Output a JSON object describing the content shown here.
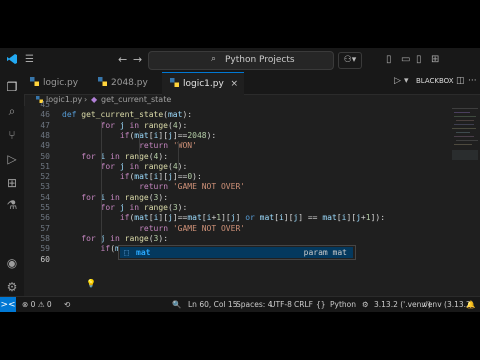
{
  "titlebar": {
    "search_text": "Python Projects",
    "nav_back": "←",
    "nav_forward": "→",
    "copilot": "⚇▾"
  },
  "tabs": [
    {
      "label": "logic.py",
      "active": false
    },
    {
      "label": "2048.py",
      "active": false
    },
    {
      "label": "logic1.py",
      "active": true
    }
  ],
  "tab_actions": {
    "run": "▷",
    "run_menu": "▾",
    "blackbox": "BLACKBOX",
    "split": "◫",
    "more": "···"
  },
  "breadcrumb": {
    "file": "logic1.py",
    "symbol": "get_current_state"
  },
  "code_lines": [
    {
      "num": "46",
      "indent": 0,
      "tokens": [
        [
          "kd",
          "def "
        ],
        [
          "fn",
          "get_current_state"
        ],
        [
          "",
          "("
        ],
        [
          "vr",
          "mat"
        ],
        [
          "",
          "):"
        ]
      ]
    },
    {
      "num": "47",
      "indent": 4,
      "tokens": [
        [
          "kw",
          "for "
        ],
        [
          "vr",
          "j"
        ],
        [
          "kw",
          " in "
        ],
        [
          "fn",
          "range"
        ],
        [
          "",
          "("
        ],
        [
          "nm",
          "4"
        ],
        [
          "",
          "):"
        ]
      ]
    },
    {
      "num": "48",
      "indent": 6,
      "tokens": [
        [
          "kw",
          "if"
        ],
        [
          "",
          "("
        ],
        [
          "vr",
          "mat"
        ],
        [
          "",
          "["
        ],
        [
          "vr",
          "i"
        ],
        [
          "",
          "]["
        ],
        [
          "vr",
          "j"
        ],
        [
          "",
          "]=="
        ],
        [
          "nm",
          "2048"
        ],
        [
          "",
          "):"
        ]
      ]
    },
    {
      "num": "49",
      "indent": 8,
      "tokens": [
        [
          "kw",
          "return "
        ],
        [
          "st",
          "'WON'"
        ]
      ]
    },
    {
      "num": "50",
      "indent": 2,
      "tokens": [
        [
          "kw",
          "for "
        ],
        [
          "vr",
          "i"
        ],
        [
          "kw",
          " in "
        ],
        [
          "fn",
          "range"
        ],
        [
          "",
          "("
        ],
        [
          "nm",
          "4"
        ],
        [
          "",
          "):"
        ]
      ]
    },
    {
      "num": "51",
      "indent": 4,
      "tokens": [
        [
          "kw",
          "for "
        ],
        [
          "vr",
          "j"
        ],
        [
          "kw",
          " in "
        ],
        [
          "fn",
          "range"
        ],
        [
          "",
          "("
        ],
        [
          "nm",
          "4"
        ],
        [
          "",
          "):"
        ]
      ]
    },
    {
      "num": "52",
      "indent": 6,
      "tokens": [
        [
          "kw",
          "if"
        ],
        [
          "",
          "("
        ],
        [
          "vr",
          "mat"
        ],
        [
          "",
          "["
        ],
        [
          "vr",
          "i"
        ],
        [
          "",
          "]["
        ],
        [
          "vr",
          "j"
        ],
        [
          "",
          "]=="
        ],
        [
          "nm",
          "0"
        ],
        [
          "",
          "):"
        ]
      ]
    },
    {
      "num": "53",
      "indent": 8,
      "tokens": [
        [
          "kw",
          "return "
        ],
        [
          "st",
          "'GAME NOT OVER'"
        ]
      ]
    },
    {
      "num": "54",
      "indent": 2,
      "tokens": [
        [
          "kw",
          "for "
        ],
        [
          "vr",
          "i"
        ],
        [
          "kw",
          " in "
        ],
        [
          "fn",
          "range"
        ],
        [
          "",
          "("
        ],
        [
          "nm",
          "3"
        ],
        [
          "",
          "):"
        ]
      ]
    },
    {
      "num": "55",
      "indent": 4,
      "tokens": [
        [
          "kw",
          "for "
        ],
        [
          "vr",
          "j"
        ],
        [
          "kw",
          " in "
        ],
        [
          "fn",
          "range"
        ],
        [
          "",
          "("
        ],
        [
          "nm",
          "3"
        ],
        [
          "",
          "):"
        ]
      ]
    },
    {
      "num": "56",
      "indent": 6,
      "tokens": [
        [
          "kw",
          "if"
        ],
        [
          "",
          "("
        ],
        [
          "vr",
          "mat"
        ],
        [
          "",
          "["
        ],
        [
          "vr",
          "i"
        ],
        [
          "",
          "]["
        ],
        [
          "vr",
          "j"
        ],
        [
          "",
          "]=="
        ],
        [
          "vr",
          "mat"
        ],
        [
          "",
          "["
        ],
        [
          "vr",
          "i"
        ],
        [
          "",
          "+"
        ],
        [
          "nm",
          "1"
        ],
        [
          "",
          "]["
        ],
        [
          "vr",
          "j"
        ],
        [
          "",
          "] "
        ],
        [
          "kd",
          "or "
        ],
        [
          "vr",
          "mat"
        ],
        [
          "",
          "["
        ],
        [
          "vr",
          "i"
        ],
        [
          "",
          "]["
        ],
        [
          "vr",
          "j"
        ],
        [
          "",
          "] == "
        ],
        [
          "vr",
          "mat"
        ],
        [
          "",
          "["
        ],
        [
          "vr",
          "i"
        ],
        [
          "",
          "]["
        ],
        [
          "vr",
          "j"
        ],
        [
          "",
          "+"
        ],
        [
          "nm",
          "1"
        ],
        [
          "",
          "]):"
        ]
      ]
    },
    {
      "num": "57",
      "indent": 8,
      "tokens": [
        [
          "kw",
          "return "
        ],
        [
          "st",
          "'GAME NOT OVER'"
        ]
      ]
    },
    {
      "num": "58",
      "indent": 2,
      "tokens": [
        [
          "kw",
          "for "
        ],
        [
          "vr",
          "j"
        ],
        [
          "kw",
          " in "
        ],
        [
          "fn",
          "range"
        ],
        [
          "",
          "("
        ],
        [
          "nm",
          "3"
        ],
        [
          "",
          "):"
        ]
      ]
    },
    {
      "num": "59",
      "indent": 4,
      "tokens": [
        [
          "kw",
          "if"
        ],
        [
          "",
          "("
        ],
        [
          "vr",
          "mat"
        ]
      ]
    },
    {
      "num": "60",
      "indent": 0,
      "tokens": []
    }
  ],
  "first_line_num": "45",
  "suggestion": {
    "symbol": "⬚",
    "name": "mat",
    "detail": "param mat"
  },
  "statusbar": {
    "remote": "><",
    "problems": "⊗ 0  ⚠ 0",
    "sync": "⟲",
    "zoom": "🔍",
    "position": "Ln 60, Col 15",
    "spaces": "Spaces: 4",
    "encoding": "UTF-8",
    "eol": "CRLF",
    "braces": "{}",
    "language": "Python",
    "version_icon": "⚙",
    "interpreter": "3.13.2 ('.venv')",
    "venv": ".venv (3.13.2)",
    "bell": "🔔"
  },
  "colors": {
    "accent": "#0078d4",
    "keyword": "#c586c0",
    "function": "#dcdcaa",
    "string": "#ce9178",
    "number": "#b5cea8",
    "variable": "#9cdcfe"
  }
}
